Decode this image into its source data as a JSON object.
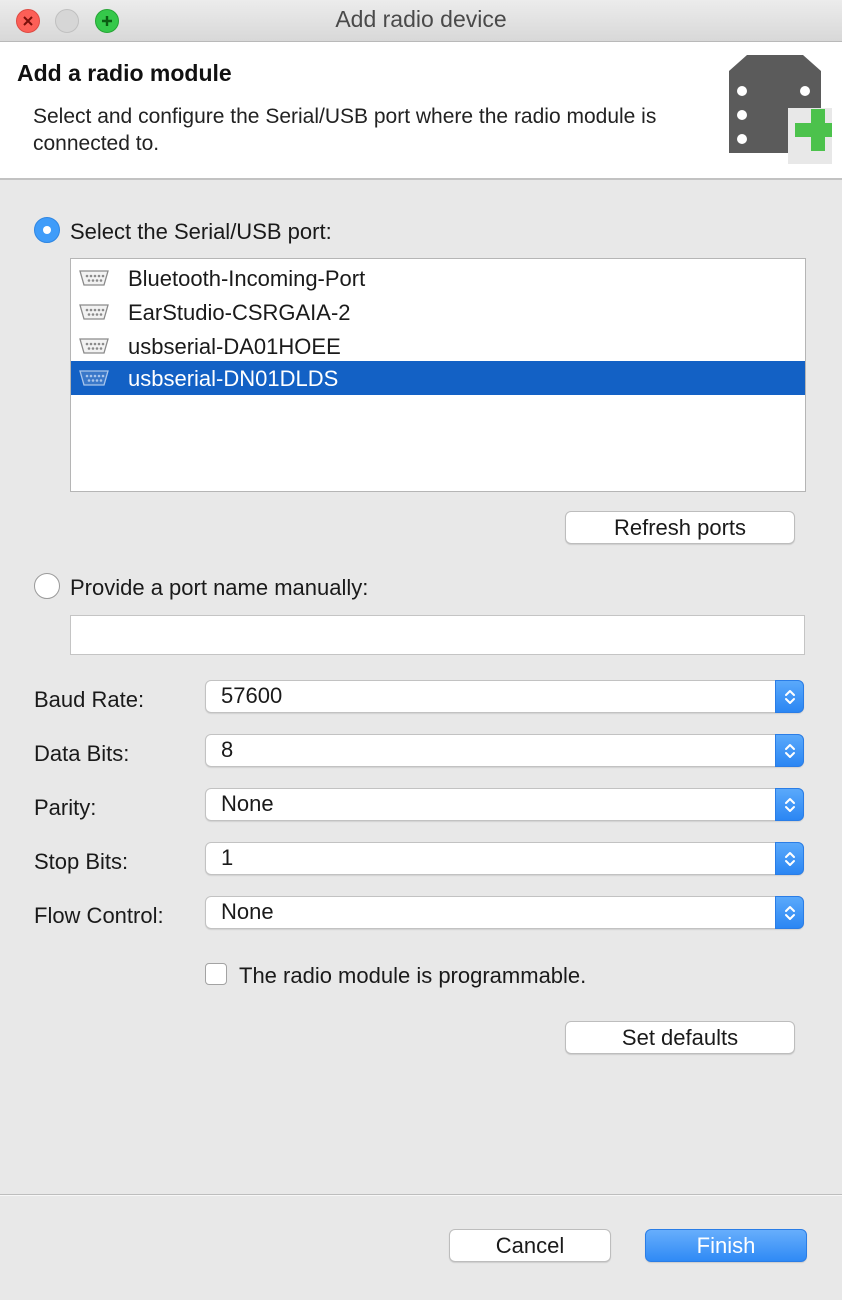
{
  "window": {
    "title": "Add radio device"
  },
  "header": {
    "title": "Add a radio module",
    "description": "Select and configure the Serial/USB port where the radio module is connected to.",
    "icon": "radio-module-add-icon"
  },
  "serial_option": {
    "label": "Select the Serial/USB port:",
    "selected": true,
    "ports": [
      {
        "name": "Bluetooth-Incoming-Port",
        "icon": "serial-port-icon"
      },
      {
        "name": "EarStudio-CSRGAIA-2",
        "icon": "serial-port-icon"
      },
      {
        "name": "usbserial-DA01HOEE",
        "icon": "serial-port-icon"
      },
      {
        "name": "usbserial-DN01DLDS",
        "icon": "serial-port-icon"
      }
    ],
    "selected_port": "usbserial-DN01DLDS",
    "refresh_label": "Refresh ports"
  },
  "manual_option": {
    "label": "Provide a port name manually:",
    "selected": false,
    "value": ""
  },
  "fields": {
    "baud_rate": {
      "label": "Baud Rate:",
      "value": "57600"
    },
    "data_bits": {
      "label": "Data Bits:",
      "value": "8"
    },
    "parity": {
      "label": "Parity:",
      "value": "None"
    },
    "stop_bits": {
      "label": "Stop Bits:",
      "value": "1"
    },
    "flow_control": {
      "label": "Flow Control:",
      "value": "None"
    }
  },
  "programmable": {
    "label": "The radio module is programmable.",
    "checked": false
  },
  "set_defaults_label": "Set defaults",
  "footer": {
    "cancel_label": "Cancel",
    "finish_label": "Finish"
  },
  "colors": {
    "accent": "#3f9cf9",
    "selection": "#1361c5",
    "add_green": "#4cc24c"
  }
}
